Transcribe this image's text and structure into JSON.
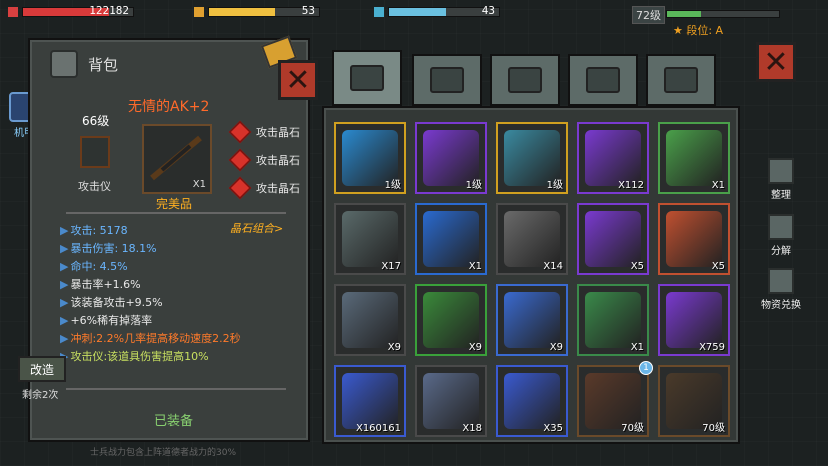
{
  "hud": {
    "hp_value": "122182",
    "energy_value": "53",
    "water_value": "43",
    "level": "72级",
    "rank": "段位: A"
  },
  "bag": {
    "title": "背包",
    "item_name": "无情的AK+2",
    "item_level": "66级",
    "attachment_label": "攻击仪",
    "weapon_count": "X1",
    "quality": "完美品",
    "gems": [
      "攻击晶石",
      "攻击晶石",
      "攻击晶石"
    ],
    "gem_combo": "晶石组合>",
    "stats": [
      {
        "text": "攻击: 5178",
        "color": "blue"
      },
      {
        "text": "暴击伤害: 18.1%",
        "color": "blue"
      },
      {
        "text": "命中: 4.5%",
        "color": "blue"
      },
      {
        "text": "暴击率+1.6%",
        "color": "white"
      },
      {
        "text": "该装备攻击+9.5%",
        "color": "white"
      },
      {
        "text": "+6%稀有掉落率",
        "color": "white"
      },
      {
        "text": "冲刺:2.2%几率提高移动速度2.2秒",
        "color": "orange"
      },
      {
        "text": "攻击仪:该道具伤害提高10%",
        "color": "green"
      }
    ],
    "equipped": "已装备",
    "modify_button": "改造",
    "remaining": "剩余2次",
    "footer": "士兵战力包含上阵道德者战力的30%"
  },
  "side_left": {
    "mech_label": "机甲"
  },
  "side_right": {
    "sort": "整理",
    "decompose": "分解",
    "exchange": "物资兑换"
  },
  "grid": [
    {
      "count": "1级",
      "color": "#2a8ad0",
      "border": "#d0a020"
    },
    {
      "count": "1级",
      "color": "#7a3ad0",
      "border": "#7a3ad0"
    },
    {
      "count": "1级",
      "color": "#3a8aa0",
      "border": "#d0a020"
    },
    {
      "count": "X112",
      "color": "#7a3ad0",
      "border": "#7a3ad0"
    },
    {
      "count": "X1",
      "color": "#4aa04a",
      "border": "#4aa04a"
    },
    {
      "count": "X17",
      "color": "#5a6a6a",
      "border": "#4a4a4a"
    },
    {
      "count": "X1",
      "color": "#2a6ad0",
      "border": "#2a6ad0"
    },
    {
      "count": "X14",
      "color": "#6a6a6a",
      "border": "#4a4a4a"
    },
    {
      "count": "X5",
      "color": "#7a3ad0",
      "border": "#7a3ad0"
    },
    {
      "count": "X5",
      "color": "#c05030",
      "border": "#c05030"
    },
    {
      "count": "X9",
      "color": "#5a6a7a",
      "border": "#4a4a4a"
    },
    {
      "count": "X9",
      "color": "#3a8a3a",
      "border": "#3aa03a"
    },
    {
      "count": "X9",
      "color": "#3a6ad0",
      "border": "#3a6ad0"
    },
    {
      "count": "X1",
      "color": "#3a8a4a",
      "border": "#3a8a4a"
    },
    {
      "count": "X759",
      "color": "#7a3ad0",
      "border": "#7a3ad0"
    },
    {
      "count": "X160161",
      "color": "#3a5ad0",
      "border": "#3a5ad0"
    },
    {
      "count": "X18",
      "color": "#5a6a8a",
      "border": "#4a4a4a"
    },
    {
      "count": "X35",
      "color": "#3a5ad0",
      "border": "#3a5ad0"
    },
    {
      "count": "70级",
      "color": "#5a3a2a",
      "border": "#6a4a2a",
      "badge": "1"
    },
    {
      "count": "70级",
      "color": "#4a3a2a",
      "border": "#6a4a2a"
    }
  ]
}
